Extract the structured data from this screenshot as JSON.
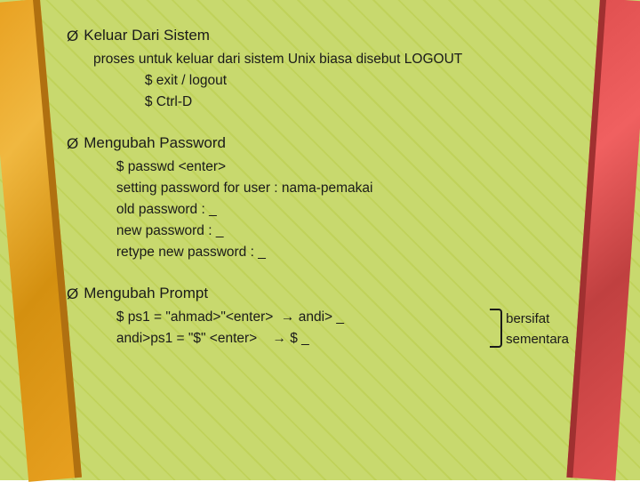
{
  "background": {
    "color": "#c8d96e"
  },
  "sections": [
    {
      "id": "keluar",
      "bullet": "Ø",
      "title": "Keluar Dari Sistem",
      "lines": [
        "proses untuk keluar dari sistem Unix biasa disebut LOGOUT",
        "      $ exit / logout",
        "      $ Ctrl-D"
      ]
    },
    {
      "id": "password",
      "bullet": "Ø",
      "title": "Mengubah Password",
      "lines": [
        "      $ passwd <enter>",
        "      setting password for user : nama-pemakai",
        "      old password : _",
        "      new password : _",
        "      retype new password : _"
      ]
    },
    {
      "id": "prompt",
      "bullet": "Ø",
      "title": "Mengubah Prompt",
      "line1": "      $ ps1 = \"ahmad>\"<enter>  → andi> _",
      "line2": "      andi>ps1 = \"$\" <enter>    → $ _",
      "bersifat": "bersifat",
      "sementara": "sementara"
    }
  ]
}
